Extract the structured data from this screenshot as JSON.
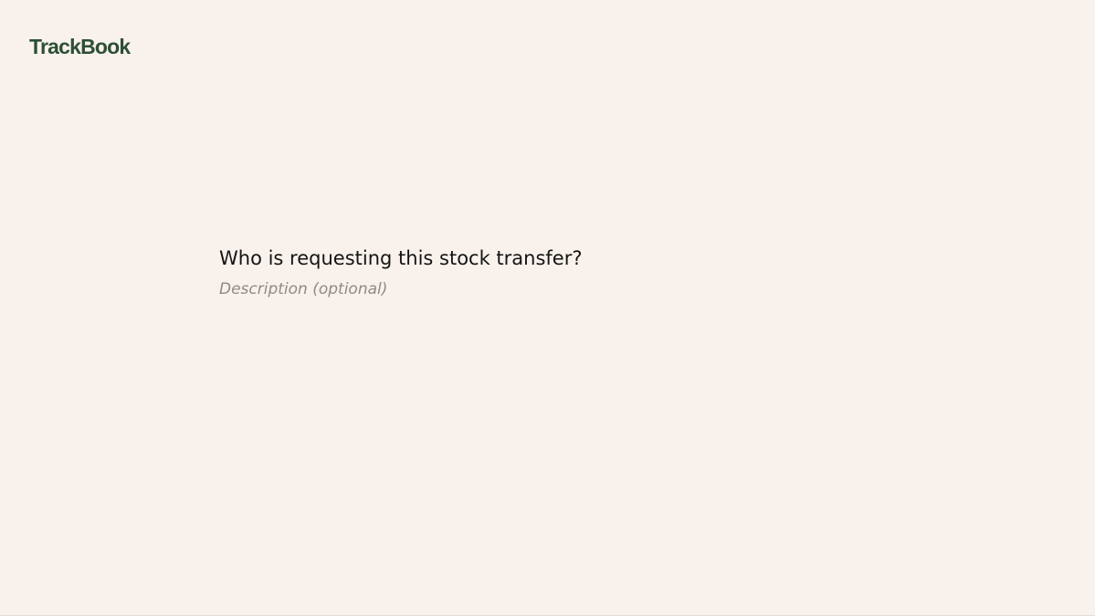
{
  "app": {
    "logo_text": "TrackBook",
    "brand_color": "#2d4f35",
    "background_color": "#f9f2ec"
  },
  "form": {
    "question": "Who is requesting this stock transfer?",
    "description": {
      "value": "",
      "placeholder": "Description (optional)"
    }
  }
}
